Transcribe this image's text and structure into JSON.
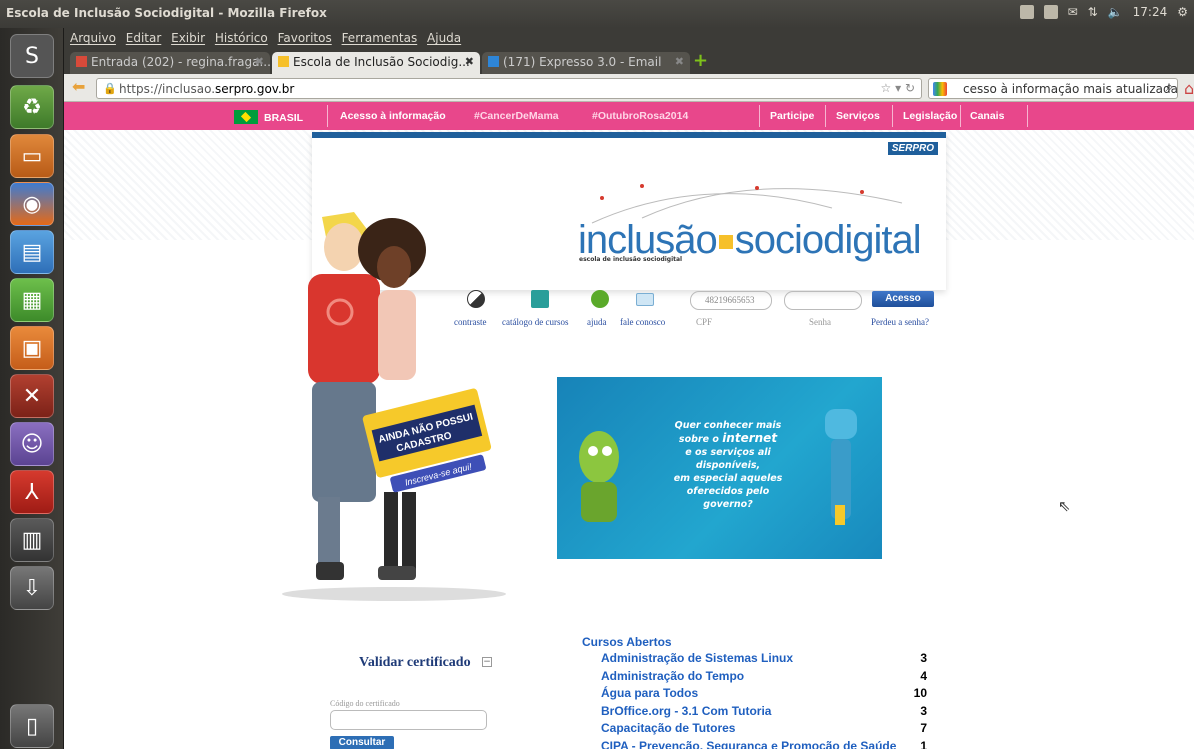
{
  "os": {
    "window_title": "Escola de Inclusão Sociodigital - Mozilla Firefox",
    "clock": "17:24"
  },
  "menu": {
    "items": [
      "Arquivo",
      "Editar",
      "Exibir",
      "Histórico",
      "Favoritos",
      "Ferramentas",
      "Ajuda"
    ]
  },
  "tabs": [
    {
      "label": "Entrada (202) - regina.fraga...",
      "active": false
    },
    {
      "label": "Escola de Inclusão Sociodig...",
      "active": true
    },
    {
      "label": "(171) Expresso 3.0 - Email",
      "active": false
    }
  ],
  "nav": {
    "url_prefix": "https://inclusao.",
    "url_domain": "serpro.gov.br",
    "search_value": "cesso à informação mais atualizada."
  },
  "govbar": {
    "brasil": "BRASIL",
    "items": [
      "Acesso à informação",
      "#CancerDeMama",
      "#OutubroRosa2014",
      "Participe",
      "Serviços",
      "Legislação",
      "Canais"
    ]
  },
  "banner": {
    "serpro": "SERPRO",
    "logo_left": "inclusão",
    "logo_right": "sociodigital",
    "logo_sub": "escola de inclusão sociodigital"
  },
  "toolbar": {
    "links": [
      "contraste",
      "catálogo de cursos",
      "ajuda",
      "fale conosco"
    ],
    "cpf_value": "48219665653",
    "cpf_label": "CPF",
    "senha_label": "Senha",
    "acesso": "Acesso",
    "forgot": "Perdeu a senha?"
  },
  "signup": {
    "line1": "AINDA NÃO POSSUI",
    "line2": "CADASTRO",
    "cta": "Inscreva-se aqui!"
  },
  "promo": {
    "line1": "Quer conhecer mais",
    "line2_a": "sobre o",
    "line2_b": "internet",
    "line3": "e os serviços ali disponíveis,",
    "line4": "em especial aqueles",
    "line5": "oferecidos pelo governo?"
  },
  "validar": {
    "title": "Validar certificado",
    "collapse": "−",
    "codigo_label": "Código do certificado",
    "button": "Consultar"
  },
  "cursos": {
    "title": "Cursos Abertos",
    "items": [
      {
        "name": "Administração de Sistemas Linux",
        "count": "3"
      },
      {
        "name": "Administração do Tempo",
        "count": "4"
      },
      {
        "name": "Água para Todos",
        "count": "10"
      },
      {
        "name": "BrOffice.org - 3.1 Com Tutoria",
        "count": "3"
      },
      {
        "name": "Capacitação de Tutores",
        "count": "7"
      },
      {
        "name": "CIPA - Prevenção, Segurança e Promoção de Saúde",
        "count": "1"
      }
    ]
  },
  "colors": {
    "govbar": "#e8478b",
    "link_blue": "#1f5fbf",
    "logo_blue": "#2d74b6"
  }
}
